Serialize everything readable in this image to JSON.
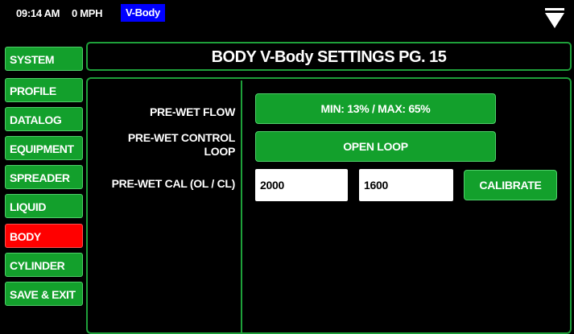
{
  "status_bar": {
    "time": "09:14 AM",
    "speed": "0 MPH",
    "profile": "V-Body",
    "menu_icon": "triangle-down-icon"
  },
  "sidebar": {
    "items": [
      {
        "label": "SYSTEM",
        "active": false
      },
      {
        "label": "PROFILE",
        "active": false
      },
      {
        "label": "DATALOG",
        "active": false
      },
      {
        "label": "EQUIPMENT",
        "active": false
      },
      {
        "label": "SPREADER",
        "active": false
      },
      {
        "label": "LIQUID",
        "active": false
      },
      {
        "label": "BODY",
        "active": true
      },
      {
        "label": "CYLINDER",
        "active": false
      },
      {
        "label": "SAVE & EXIT",
        "active": false
      }
    ]
  },
  "header": {
    "title": "BODY V-Body SETTINGS PG. 15"
  },
  "settings": {
    "prewet_flow": {
      "label": "PRE-WET FLOW",
      "value": "MIN: 13% / MAX: 65%"
    },
    "prewet_control_loop": {
      "label_line1": "PRE-WET CONTROL",
      "label_line2": "LOOP",
      "value": "OPEN LOOP"
    },
    "prewet_cal": {
      "label": "PRE-WET CAL (OL / CL)",
      "open_loop_value": "2000",
      "closed_loop_value": "1600",
      "calibrate_label": "CALIBRATE"
    }
  },
  "colors": {
    "button_green": "#13a02c",
    "active_red": "#ff0000",
    "profile_blue": "#0000ff",
    "border_green": "#1ea03a",
    "background": "#000000"
  }
}
